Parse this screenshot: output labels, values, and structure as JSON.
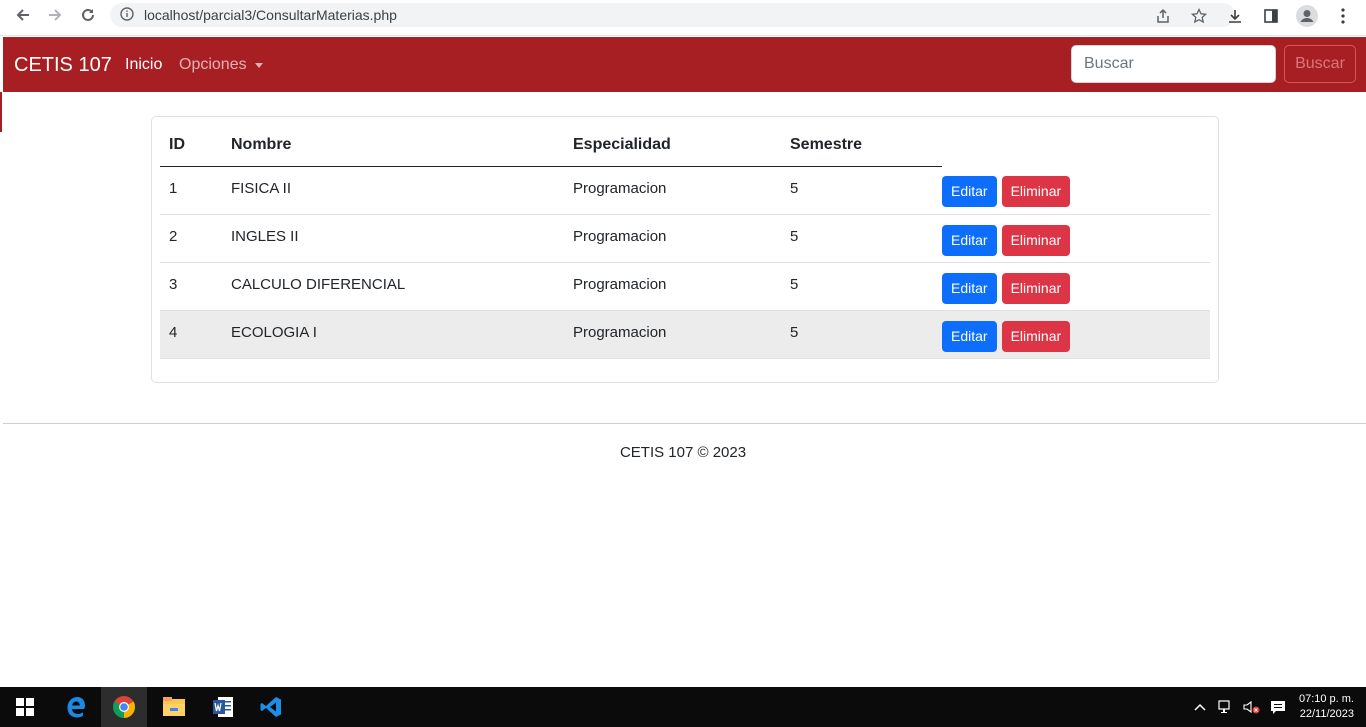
{
  "browser": {
    "url": "localhost/parcial3/ConsultarMaterias.php"
  },
  "navbar": {
    "brand": "CETIS 107",
    "inicio": "Inicio",
    "opciones": "Opciones",
    "search_placeholder": "Buscar",
    "search_button": "Buscar"
  },
  "table": {
    "headers": [
      "ID",
      "Nombre",
      "Especialidad",
      "Semestre"
    ],
    "rows": [
      {
        "id": "1",
        "nombre": "FISICA II",
        "especialidad": "Programacion",
        "semestre": "5"
      },
      {
        "id": "2",
        "nombre": "INGLES II",
        "especialidad": "Programacion",
        "semestre": "5"
      },
      {
        "id": "3",
        "nombre": "CALCULO DIFERENCIAL",
        "especialidad": "Programacion",
        "semestre": "5"
      },
      {
        "id": "4",
        "nombre": "ECOLOGIA I",
        "especialidad": "Programacion",
        "semestre": "5"
      }
    ],
    "edit_label": "Editar",
    "delete_label": "Eliminar"
  },
  "footer": {
    "text": "CETIS 107 © 2023"
  },
  "taskbar": {
    "time": "07:10 p. m.",
    "date": "22/11/2023"
  },
  "colors": {
    "navbar": "#a71f23",
    "edit": "#0d6efd",
    "delete": "#dc3545"
  }
}
